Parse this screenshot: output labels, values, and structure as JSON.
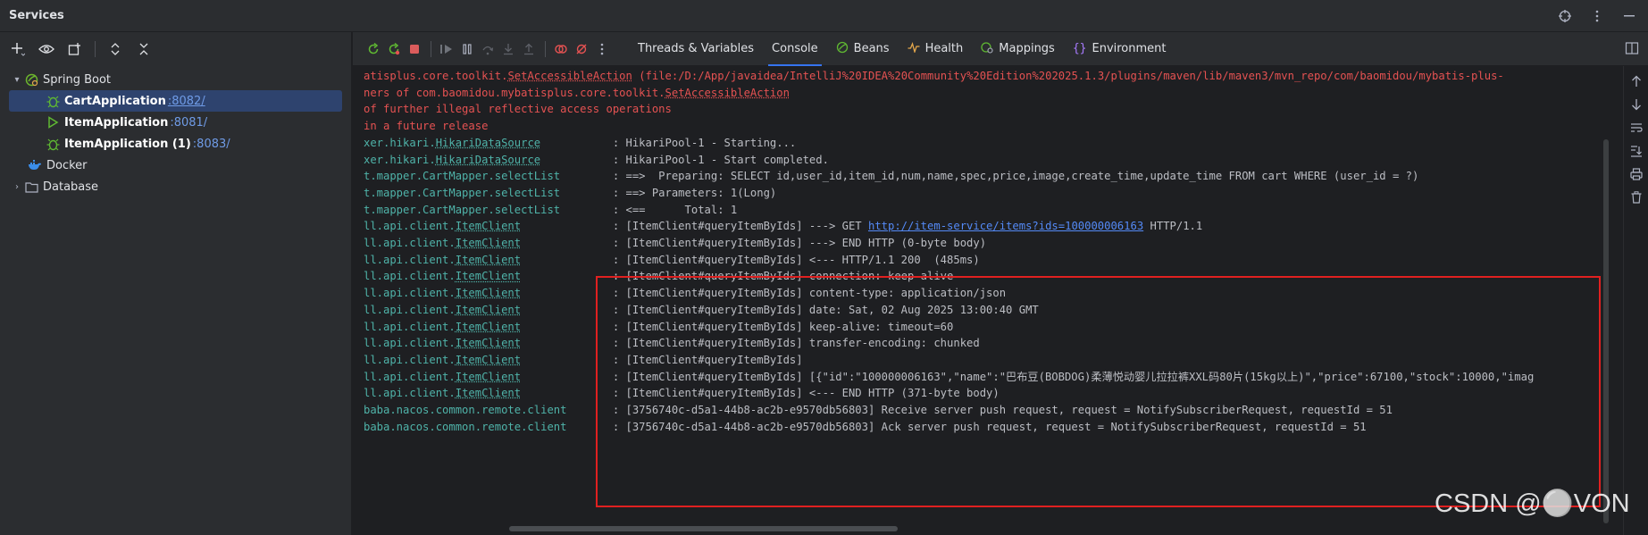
{
  "window": {
    "title": "Services"
  },
  "tree": {
    "spring_boot": "Spring Boot",
    "apps": [
      {
        "name": "CartApplication",
        "port": ":8082/"
      },
      {
        "name": "ItemApplication",
        "port": ":8081/"
      },
      {
        "name": "ItemApplication (1)",
        "port": ":8083/"
      }
    ],
    "docker": "Docker",
    "database": "Database"
  },
  "tabs": {
    "threads": "Threads & Variables",
    "console": "Console",
    "beans": "Beans",
    "health": "Health",
    "mappings": "Mappings",
    "environment": "Environment"
  },
  "icons": {
    "title_actions": [
      "target-icon",
      "more-vert-icon",
      "minimize-icon"
    ],
    "left_toolbar": [
      "add-icon",
      "eye-icon",
      "new-window-icon",
      "expand-all-icon",
      "collapse-all-icon"
    ],
    "console_side": [
      "arrow-up-icon",
      "arrow-down-icon",
      "soft-wrap-icon",
      "scroll-end-icon",
      "print-icon",
      "trash-icon"
    ]
  },
  "colors": {
    "error_text": "#e55252",
    "class_text": "#4fb3a9",
    "link": "#548af7",
    "selection": "#2e436e",
    "highlight_box": "#e02020"
  },
  "console": {
    "warn_lines": [
      {
        "pre": "atisplus.core.toolkit.",
        "link": "SetAccessibleAction",
        "post": " (file:/D:/App/javaidea/IntelliJ%20IDEA%20Community%20Edition%202025.1.3/plugins/maven/lib/maven3/mvn_repo/com/baomidou/mybatis-plus-"
      },
      {
        "pre": "ners of com.baomidou.mybatisplus.core.toolkit.",
        "link": "SetAccessibleAction",
        "post": ""
      },
      {
        "pre": "of further illegal reflective access operations",
        "link": "",
        "post": ""
      },
      {
        "pre": "in a future release",
        "link": "",
        "post": ""
      }
    ],
    "log_lines": [
      {
        "src_pre": "xer.hikari.",
        "src_link": "HikariDataSource",
        "msg_pre": ": HikariPool-1 - Starting...",
        "url": "",
        "msg_post": ""
      },
      {
        "src_pre": "xer.hikari.",
        "src_link": "HikariDataSource",
        "msg_pre": ": HikariPool-1 - Start completed.",
        "url": "",
        "msg_post": ""
      },
      {
        "src_pre": "t.mapper.CartMapper.selectList",
        "src_link": "",
        "msg_pre": ": ==>  Preparing: SELECT id,user_id,item_id,num,name,spec,price,image,create_time,update_time FROM cart WHERE (user_id = ?)",
        "url": "",
        "msg_post": ""
      },
      {
        "src_pre": "t.mapper.CartMapper.selectList",
        "src_link": "",
        "msg_pre": ": ==> Parameters: 1(Long)",
        "url": "",
        "msg_post": ""
      },
      {
        "src_pre": "t.mapper.CartMapper.selectList",
        "src_link": "",
        "msg_pre": ": <==      Total: 1",
        "url": "",
        "msg_post": ""
      },
      {
        "src_pre": "ll.api.client.",
        "src_link": "ItemClient",
        "msg_pre": ": [ItemClient#queryItemByIds] ---> GET ",
        "url": "http://item-service/items?ids=100000006163",
        "msg_post": " HTTP/1.1"
      },
      {
        "src_pre": "ll.api.client.",
        "src_link": "ItemClient",
        "msg_pre": ": [ItemClient#queryItemByIds] ---> END HTTP (0-byte body)",
        "url": "",
        "msg_post": ""
      },
      {
        "src_pre": "ll.api.client.",
        "src_link": "ItemClient",
        "msg_pre": ": [ItemClient#queryItemByIds] <--- HTTP/1.1 200  (485ms)",
        "url": "",
        "msg_post": ""
      },
      {
        "src_pre": "ll.api.client.",
        "src_link": "ItemClient",
        "msg_pre": ": [ItemClient#queryItemByIds] connection: keep-alive",
        "url": "",
        "msg_post": ""
      },
      {
        "src_pre": "ll.api.client.",
        "src_link": "ItemClient",
        "msg_pre": ": [ItemClient#queryItemByIds] content-type: application/json",
        "url": "",
        "msg_post": ""
      },
      {
        "src_pre": "ll.api.client.",
        "src_link": "ItemClient",
        "msg_pre": ": [ItemClient#queryItemByIds] date: Sat, 02 Aug 2025 13:00:40 GMT",
        "url": "",
        "msg_post": ""
      },
      {
        "src_pre": "ll.api.client.",
        "src_link": "ItemClient",
        "msg_pre": ": [ItemClient#queryItemByIds] keep-alive: timeout=60",
        "url": "",
        "msg_post": ""
      },
      {
        "src_pre": "ll.api.client.",
        "src_link": "ItemClient",
        "msg_pre": ": [ItemClient#queryItemByIds] transfer-encoding: chunked",
        "url": "",
        "msg_post": ""
      },
      {
        "src_pre": "ll.api.client.",
        "src_link": "ItemClient",
        "msg_pre": ": [ItemClient#queryItemByIds]",
        "url": "",
        "msg_post": ""
      },
      {
        "src_pre": "ll.api.client.",
        "src_link": "ItemClient",
        "msg_pre": ": [ItemClient#queryItemByIds] [{\"id\":\"100000006163\",\"name\":\"巴布豆(BOBDOG)柔薄悦动婴儿拉拉裤XXL码80片(15kg以上)\",\"price\":67100,\"stock\":10000,\"imag",
        "url": "",
        "msg_post": ""
      },
      {
        "src_pre": "ll.api.client.",
        "src_link": "ItemClient",
        "msg_pre": ": [ItemClient#queryItemByIds] <--- END HTTP (371-byte body)",
        "url": "",
        "msg_post": ""
      },
      {
        "src_pre": "baba.nacos.common.remote.client",
        "src_link": "",
        "msg_pre": ": [3756740c-d5a1-44b8-ac2b-e9570db56803] Receive server push request, request = NotifySubscriberRequest, requestId = 51",
        "url": "",
        "msg_post": ""
      },
      {
        "src_pre": "baba.nacos.common.remote.client",
        "src_link": "",
        "msg_pre": ": [3756740c-d5a1-44b8-ac2b-e9570db56803] Ack server push request, request = NotifySubscriberRequest, requestId = 51",
        "url": "",
        "msg_post": ""
      }
    ]
  },
  "watermark": "CSDN @⚪VON"
}
